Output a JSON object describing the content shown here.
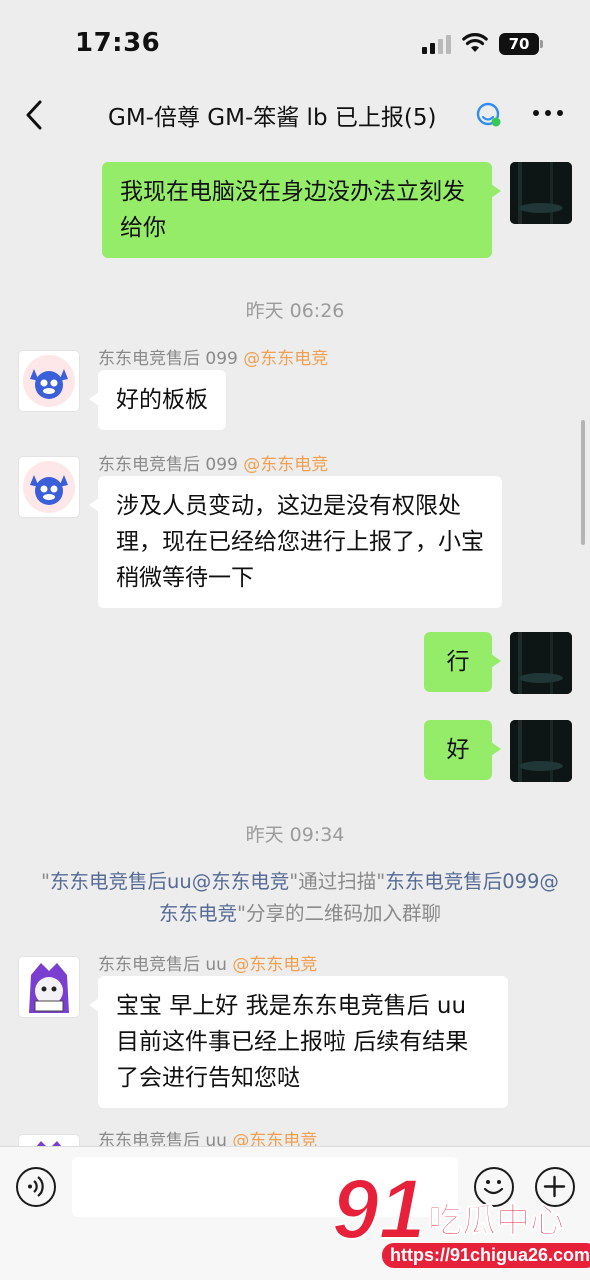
{
  "status_bar": {
    "time": "17:36",
    "battery": "70"
  },
  "nav": {
    "title": "GM-倍尊 GM-笨酱 lb 已上报(5)"
  },
  "messages": {
    "m1": {
      "text": "我现在电脑没在身边没办法立刻发给你"
    },
    "t1": "昨天 06:26",
    "m2": {
      "sender": "东东电竞售后 099",
      "sender_tag": "@东东电竞",
      "text": "好的板板"
    },
    "m3": {
      "sender": "东东电竞售后 099",
      "sender_tag": "@东东电竞",
      "text": "涉及人员变动，这边是没有权限处理，现在已经给您进行上报了，小宝稍微等待一下"
    },
    "m4": {
      "text": "行"
    },
    "m5": {
      "text": "好"
    },
    "t2": "昨天 09:34",
    "sys": {
      "q1": "\"",
      "inviter_link": "东东电竞售后uu@东东电竞",
      "q2": "\"通过扫描\"",
      "sharer_link": "东东电竞售后099@东东电竞",
      "q3": "\"分享的二维码加入群聊"
    },
    "m6": {
      "sender": "东东电竞售后 uu",
      "sender_tag": "@东东电竞",
      "text": "宝宝 早上好 我是东东电竞售后 uu 目前这件事已经上报啦 后续有结果了会进行告知您哒"
    },
    "m7": {
      "sender": "东东电竞售后 uu",
      "sender_tag": "@东东电竞"
    }
  },
  "watermark": {
    "logo_number": "91",
    "logo_text": "吃瓜中心",
    "url": "https://91chigua26.com"
  },
  "colors": {
    "bubble_me": "#95ec69",
    "link": "#576b95",
    "tag": "#f0a050",
    "watermark": "#e8213a"
  }
}
